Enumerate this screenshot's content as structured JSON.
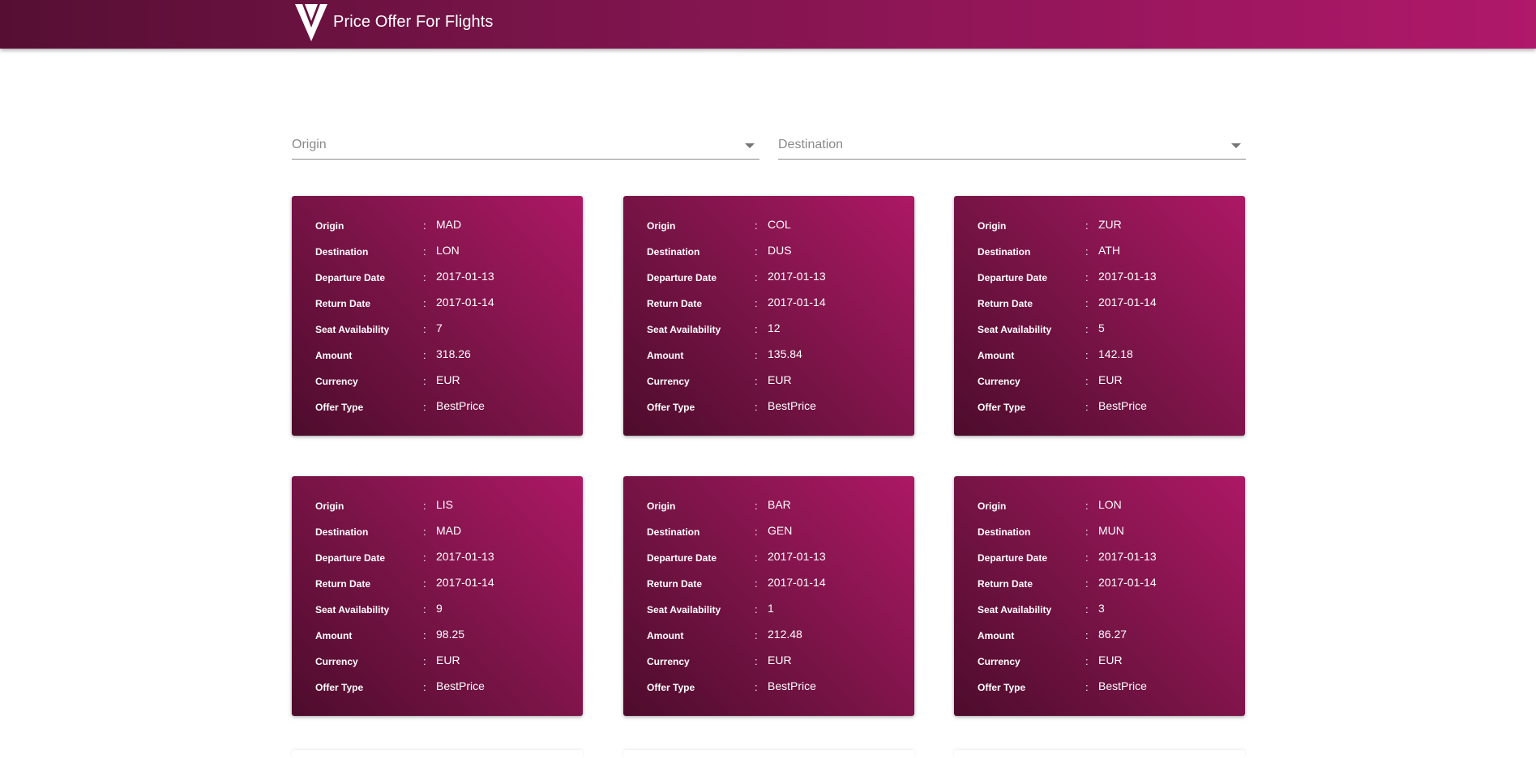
{
  "header": {
    "title": "Price Offer For Flights",
    "logo_icon": "v-logo-icon",
    "gradient": [
      "#560f33",
      "#b0186a"
    ]
  },
  "filters": {
    "origin_placeholder": "Origin",
    "destination_placeholder": "Destination"
  },
  "card_labels": {
    "origin": "Origin",
    "destination": "Destination",
    "departure_date": "Departure Date",
    "return_date": "Return Date",
    "seat_availability": "Seat Availability",
    "amount": "Amount",
    "currency": "Currency",
    "offer_type": "Offer Type",
    "separator": ":"
  },
  "offers": [
    {
      "origin": "MAD",
      "destination": "LON",
      "departure_date": "2017-01-13",
      "return_date": "2017-01-14",
      "seat_availability": "7",
      "amount": "318.26",
      "currency": "EUR",
      "offer_type": "BestPrice"
    },
    {
      "origin": "COL",
      "destination": "DUS",
      "departure_date": "2017-01-13",
      "return_date": "2017-01-14",
      "seat_availability": "12",
      "amount": "135.84",
      "currency": "EUR",
      "offer_type": "BestPrice"
    },
    {
      "origin": "ZUR",
      "destination": "ATH",
      "departure_date": "2017-01-13",
      "return_date": "2017-01-14",
      "seat_availability": "5",
      "amount": "142.18",
      "currency": "EUR",
      "offer_type": "BestPrice"
    },
    {
      "origin": "LIS",
      "destination": "MAD",
      "departure_date": "2017-01-13",
      "return_date": "2017-01-14",
      "seat_availability": "9",
      "amount": "98.25",
      "currency": "EUR",
      "offer_type": "BestPrice"
    },
    {
      "origin": "BAR",
      "destination": "GEN",
      "departure_date": "2017-01-13",
      "return_date": "2017-01-14",
      "seat_availability": "1",
      "amount": "212.48",
      "currency": "EUR",
      "offer_type": "BestPrice"
    },
    {
      "origin": "LON",
      "destination": "MUN",
      "departure_date": "2017-01-13",
      "return_date": "2017-01-14",
      "seat_availability": "3",
      "amount": "86.27",
      "currency": "EUR",
      "offer_type": "BestPrice"
    }
  ]
}
